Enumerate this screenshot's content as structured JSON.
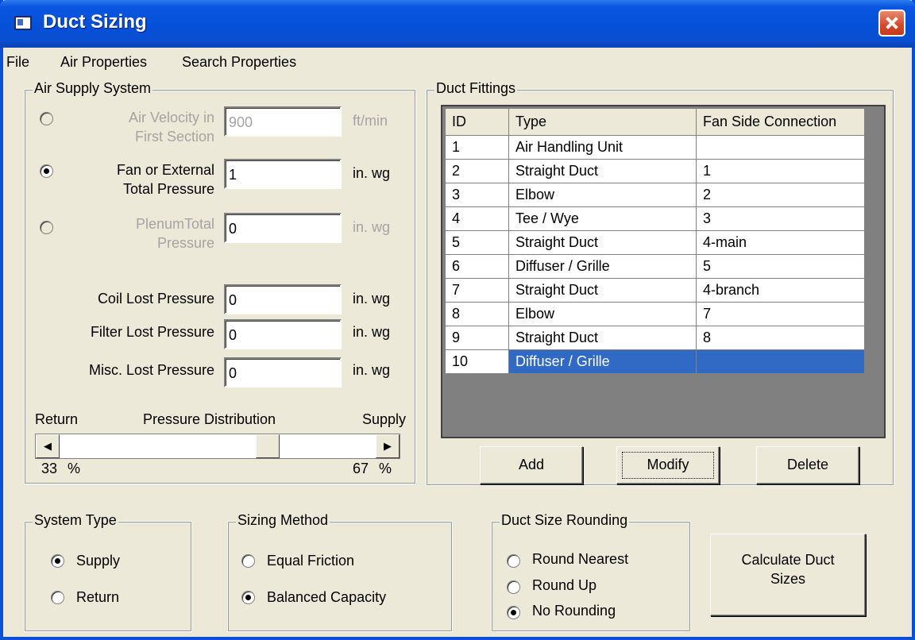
{
  "window": {
    "title": "Duct Sizing"
  },
  "menu": [
    "File",
    "Air Properties",
    "Search Properties"
  ],
  "air_supply": {
    "label": "Air Supply System",
    "velocity": {
      "label_line1": "Air Velocity in",
      "label_line2": "First Section",
      "value": "900",
      "unit": "ft/min",
      "selected": false,
      "enabled": false
    },
    "fan_pressure": {
      "label_line1": "Fan or External",
      "label_line2": "Total Pressure",
      "value": "1",
      "unit": "in. wg",
      "selected": true,
      "enabled": true
    },
    "plenum_pressure": {
      "label_line1": "PlenumTotal",
      "label_line2": "Pressure",
      "value": "0",
      "unit": "in. wg",
      "selected": false,
      "enabled": false
    },
    "coil": {
      "label": "Coil Lost Pressure",
      "value": "0",
      "unit": "in. wg"
    },
    "filter": {
      "label": "Filter Lost Pressure",
      "value": "0",
      "unit": "in. wg"
    },
    "misc": {
      "label": "Misc. Lost Pressure",
      "value": "0",
      "unit": "in. wg"
    },
    "distribution": {
      "label": "Pressure Distribution",
      "left_label": "Return",
      "right_label": "Supply",
      "return_pct": "33",
      "supply_pct": "67",
      "pct_symbol": "%",
      "slider_fraction": 0.67
    }
  },
  "fittings": {
    "label": "Duct Fittings",
    "columns": [
      "ID",
      "Type",
      "Fan Side Connection"
    ],
    "rows": [
      [
        "1",
        "Air Handling Unit",
        ""
      ],
      [
        "2",
        "Straight Duct",
        "1"
      ],
      [
        "3",
        "Elbow",
        "2"
      ],
      [
        "4",
        "Tee / Wye",
        "3"
      ],
      [
        "5",
        "Straight Duct",
        "4-main"
      ],
      [
        "6",
        "Diffuser / Grille",
        "5"
      ],
      [
        "7",
        "Straight Duct",
        "4-branch"
      ],
      [
        "8",
        "Elbow",
        "7"
      ],
      [
        "9",
        "Straight Duct",
        "8"
      ],
      [
        "10",
        "Diffuser / Grille",
        ""
      ]
    ],
    "selected_row": 9,
    "buttons": {
      "add": "Add",
      "modify": "Modify",
      "delete": "Delete"
    }
  },
  "system_type": {
    "label": "System Type",
    "options": [
      "Supply",
      "Return"
    ],
    "selected": 0
  },
  "sizing_method": {
    "label": "Sizing Method",
    "options": [
      "Equal Friction",
      "Balanced Capacity"
    ],
    "selected": 1
  },
  "rounding": {
    "label": "Duct Size Rounding",
    "options": [
      "Round Nearest",
      "Round Up",
      "No Rounding"
    ],
    "selected": 2
  },
  "calculate": {
    "line1": "Calculate Duct",
    "line2": "Sizes"
  }
}
